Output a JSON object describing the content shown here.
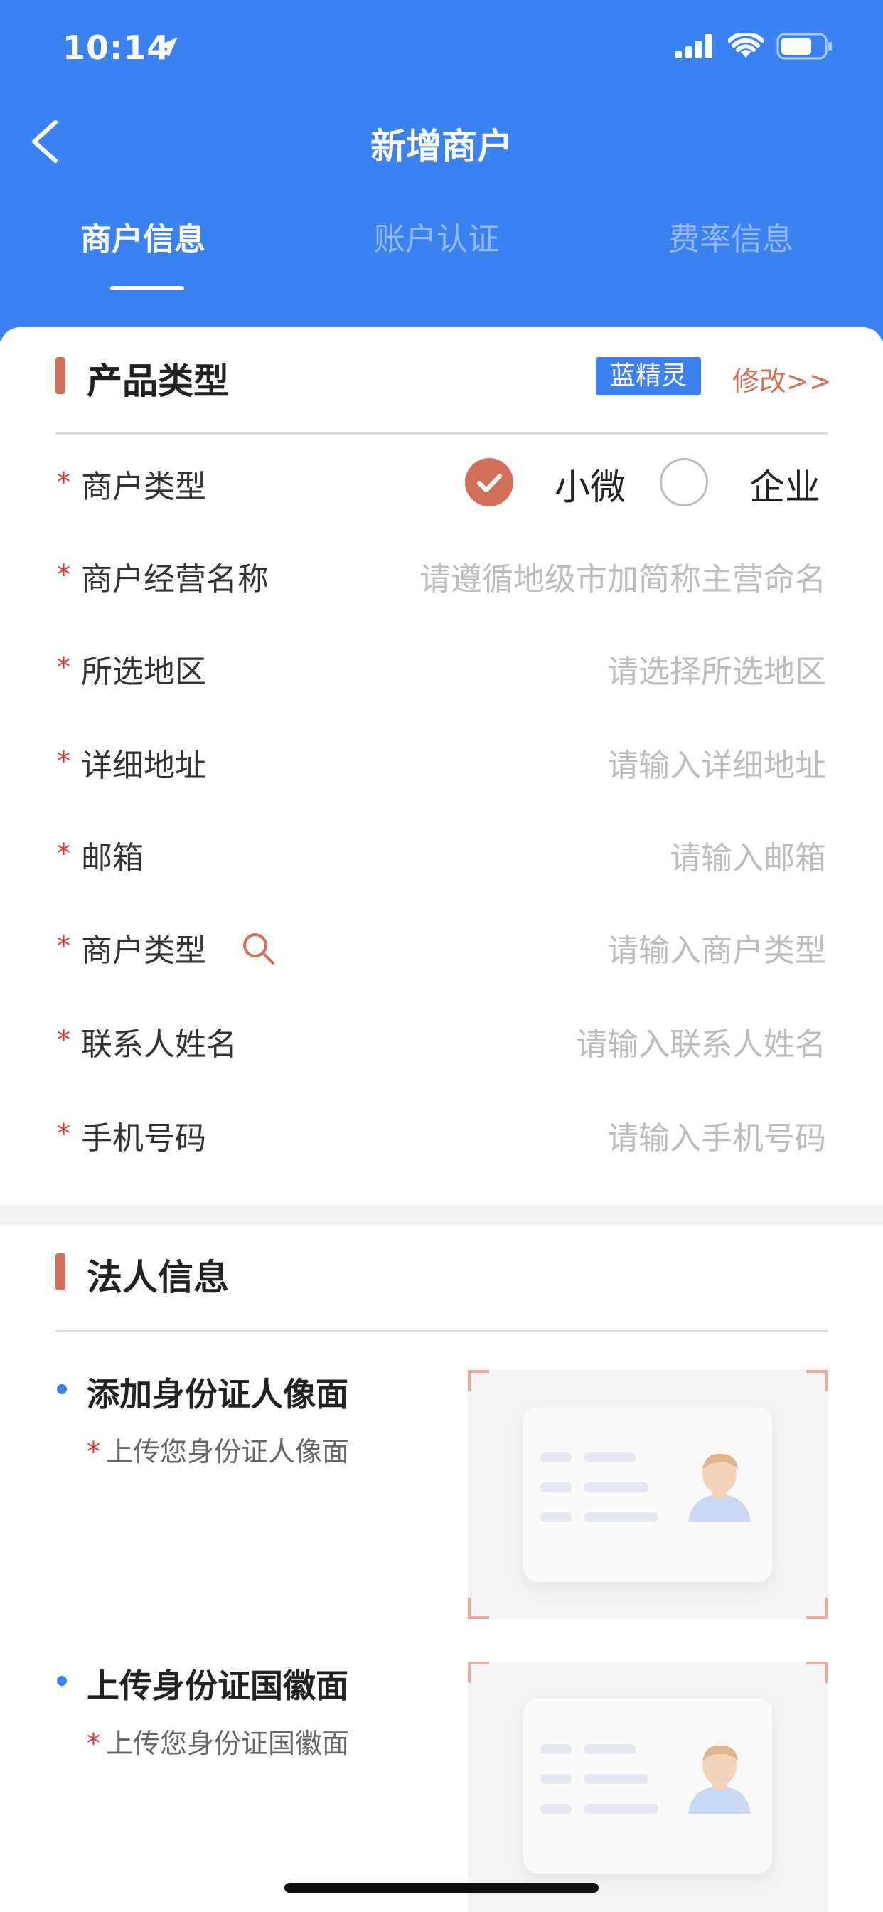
{
  "status_bar": {
    "time": "10:14"
  },
  "nav": {
    "title": "新增商户"
  },
  "tabs": [
    {
      "label": "商户信息",
      "active": true
    },
    {
      "label": "账户认证",
      "active": false
    },
    {
      "label": "费率信息",
      "active": false
    }
  ],
  "product_section": {
    "title": "产品类型",
    "badge": "蓝精灵",
    "edit_link": "修改>>"
  },
  "merchant_type_row": {
    "star": "*",
    "label": "商户类型",
    "options": [
      {
        "label": "小微",
        "selected": true
      },
      {
        "label": "企业",
        "selected": false
      }
    ]
  },
  "form_rows": [
    {
      "star": "*",
      "label": "商户经营名称",
      "placeholder": "请遵循地级市加简称主营命名"
    },
    {
      "star": "*",
      "label": "所选地区",
      "placeholder": "请选择所选地区"
    },
    {
      "star": "*",
      "label": "详细地址",
      "placeholder": "请输入详细地址"
    },
    {
      "star": "*",
      "label": "邮箱",
      "placeholder": "请输入邮箱"
    },
    {
      "star": "*",
      "label": "商户类型",
      "placeholder": "请输入商户类型",
      "icon": "search-icon"
    },
    {
      "star": "*",
      "label": "联系人姓名",
      "placeholder": "请输入联系人姓名"
    },
    {
      "star": "*",
      "label": "手机号码",
      "placeholder": "请输入手机号码"
    }
  ],
  "legal_section": {
    "title": "法人信息",
    "uploads": [
      {
        "title": "添加身份证人像面",
        "star": "*",
        "subtitle": "上传您身份证人像面"
      },
      {
        "title": "上传身份证国徽面",
        "star": "*",
        "subtitle": "上传您身份证国徽面"
      }
    ]
  },
  "colors": {
    "brand_blue": "#3b82f0",
    "accent_red": "#d4705a",
    "required_star": "#d33a3a"
  }
}
